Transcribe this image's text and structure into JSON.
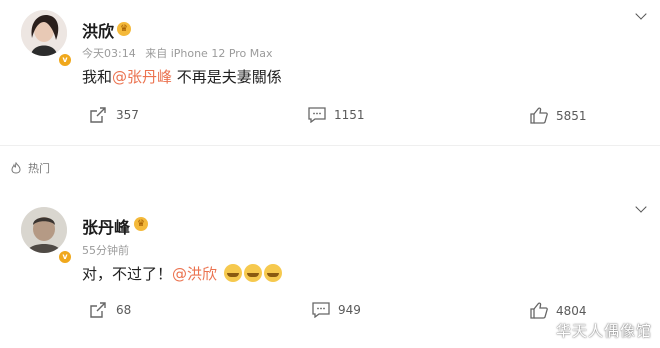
{
  "post1": {
    "username": "洪欣",
    "time": "今天03:14",
    "source": "来自 iPhone 12 Pro Max",
    "content_pre": "我和",
    "mention": "@张丹峰",
    "content_post": " 不再是夫妻關係",
    "repost_count": "357",
    "comment_count": "1151",
    "like_count": "5851"
  },
  "hot_label": "热门",
  "post2": {
    "username": "张丹峰",
    "time": "55分钟前",
    "content_pre": "对，不过了！",
    "mention": "@洪欣",
    "emoji_count": 3,
    "repost_count": "68",
    "comment_count": "949",
    "like_count": "4804"
  },
  "watermark": "华天人偶像馆",
  "colors": {
    "mention": "#eb7350",
    "verified_badge": "#f0a81c"
  },
  "icons": [
    "verified-badge-icon",
    "crown-icon",
    "chevron-down-icon",
    "repost-icon",
    "comment-icon",
    "like-icon",
    "fire-icon",
    "laugh-emoji-icon"
  ]
}
